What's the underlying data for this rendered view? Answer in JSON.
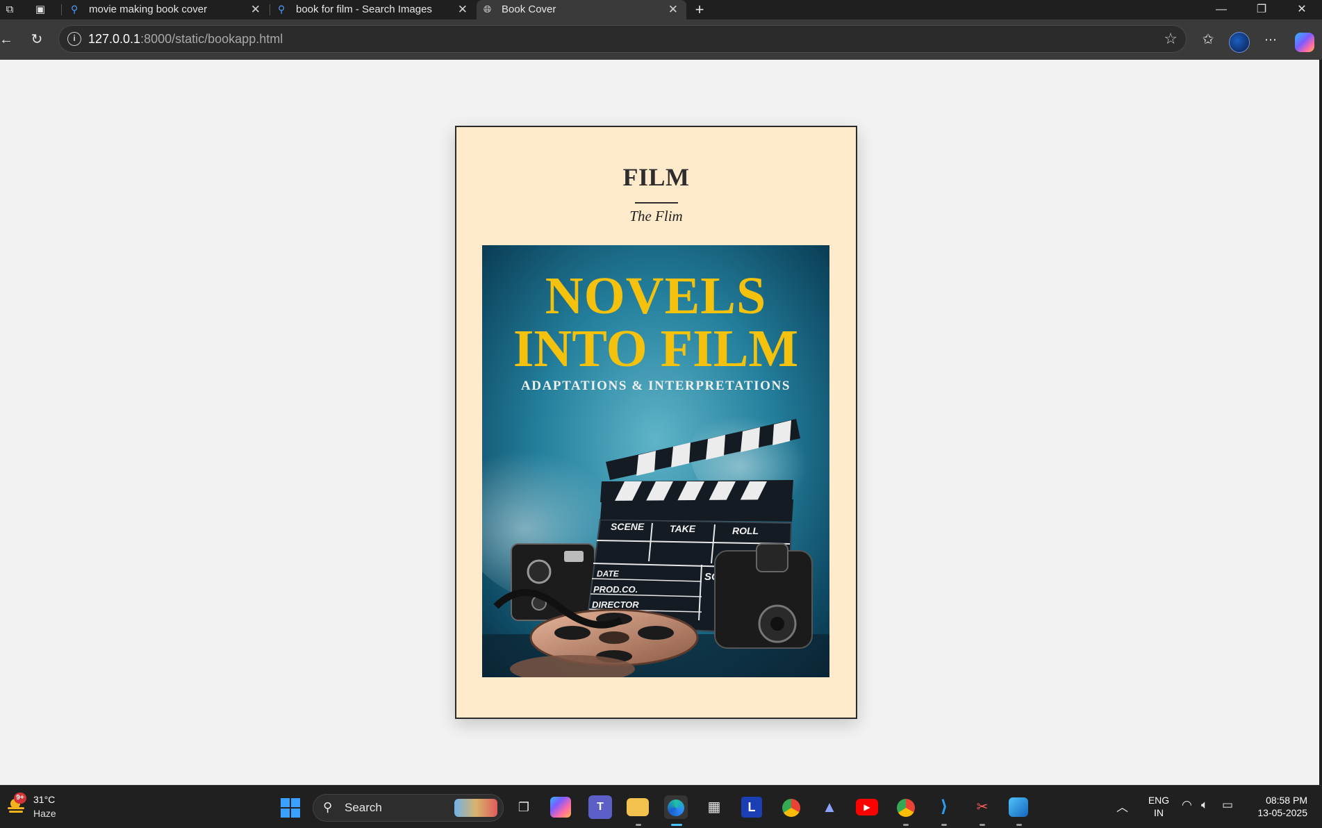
{
  "browser": {
    "tabs": [
      {
        "title": "movie making book cover",
        "icon": "search-icon",
        "active": false
      },
      {
        "title": "book for film - Search Images",
        "icon": "search-icon",
        "active": false
      },
      {
        "title": "Book Cover",
        "icon": "globe-icon",
        "active": true
      }
    ],
    "new_tab_glyph": "+",
    "window_controls": {
      "minimize": "—",
      "restore": "❐",
      "close": "✕"
    },
    "address": {
      "host": "127.0.0.1",
      "path": ":8000/static/bookapp.html"
    },
    "toolbar_icons": [
      "back-arrow-icon",
      "reload-icon",
      "site-info-icon",
      "favorite-star-icon",
      "favorites-icon",
      "profile-avatar",
      "more-menu-icon",
      "copilot-icon"
    ]
  },
  "book": {
    "title": "FILM",
    "subtitle": "The Flim",
    "cover": {
      "line1": "NOVELS",
      "line2": "INTO FILM",
      "tagline": "ADAPTATIONS & INTERPRETATIONS",
      "clapper": {
        "scene": "SCENE",
        "take": "TAKE",
        "roll": "ROLL",
        "date": "DATE",
        "sound": "SOUND",
        "prod": "PROD.CO.",
        "director": "DIRECTOR"
      },
      "colors": {
        "heading": "#f4c20d",
        "background": "#1b6f8a"
      }
    },
    "page_color": "#ffebcc"
  },
  "taskbar": {
    "weather": {
      "temp": "31°C",
      "condition": "Haze",
      "badge": "9+"
    },
    "search_label": "Search",
    "apps": [
      "task-view-icon",
      "copilot-app-icon",
      "teams-icon",
      "file-explorer-icon",
      "edge-icon",
      "store-icon",
      "l-app-icon",
      "chrome-icon",
      "arc-icon",
      "youtube-icon",
      "chrome-profile-icon",
      "vscode-icon",
      "snipping-tool-icon",
      "photos-icon"
    ],
    "lang_top": "ENG",
    "lang_bottom": "IN",
    "time": "08:58 PM",
    "date": "13-05-2025"
  }
}
